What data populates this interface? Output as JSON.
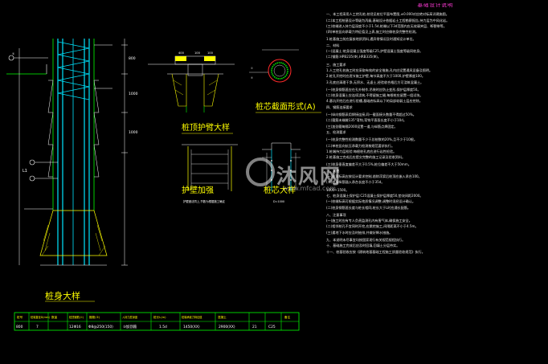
{
  "drawing": {
    "pile_body_title": "桩身大样",
    "pile_cap_title": "桩顶护臂大样",
    "wall_title": "护壁加强",
    "section_title": "桩芯截面形式(A)",
    "section2_title": "桩芯大样",
    "dim_labels": [
      "800",
      "1000",
      "1000",
      "L1"
    ],
    "cap_dims": [
      "400",
      "100",
      "100"
    ],
    "wall_note": "护壁做法同上,节数为根据施工确定",
    "d_label": "D=1000"
  },
  "table": {
    "headers": [
      "桩号",
      "桩端直径D(mm)",
      "数量",
      "桩顶钢筋(①)",
      "箍筋(②)",
      "入持力层深度",
      "桩长L(m)",
      "桩端承载力特征值",
      "混凝土",
      "备注"
    ],
    "row": [
      "800",
      "7",
      "12Φ16",
      "Φ8@250(150)",
      "③加劲箍",
      "1.5d",
      "1450(XX)",
      "2900(XX)",
      "21",
      "C25"
    ]
  },
  "notes": {
    "title": "基础设计说明",
    "lines": [
      "一、本工程采用人工挖孔桩,桩径见桩位平面布置图,±0.000对应绝对标高详建施图。",
      "(二)本工程桩基设计等级为丙级,基础设计依据岩土工程勘察报告,持力层为中风化岩。",
      "(三)桩端进入持力层深度不小于1.5d,桩端以下3d范围内应无软弱夹层、断裂带等。",
      "(四)单桩竖向承载力特征值见上表,施工时应做桩身完整性检测。",
      "1.桩基施工前应复核地质资料,遇异常情况及时通知设计单位。",
      "二、材料",
      "(一)混凝土:桩身混凝土强度等级C25,护壁混凝土强度等级同桩身。",
      "(二)钢筋:HPB235(Φ),HRB335(Φ)。",
      "三、施工要求",
      "1.人工挖孔桩施工时应采取有效的安全措施,孔内应设置通风设备及照明。",
      "2.桩孔开挖时应逐节施工护壁,每节高度不大于1000,护壁厚度100。",
      "3.孔底应清理干净,无积水、无虚土,经验收合格后方可浇筑混凝土。",
      "(一)桩身钢筋笼应在孔外制作,吊装时应防止变形,保护层厚度50。",
      "(二)桩身混凝土应连续浇筑,不得留施工缝,每根桩应留置一组试块。",
      "4.基坑开挖后应进行验槽,基础底标高以下的局部软弱土层应挖除。",
      "四、钢筋连接要求",
      "(一)纵向钢筋采用焊接连接,同一截面接头数量不得超过50%。",
      "(二)箍筋末端做135°弯钩,弯钩平直段长度不小于10d。",
      "(三)加劲箍每隔2000设置一道,与纵筋点焊固定。",
      "五、检测要求",
      "(一)桩身完整性检测数量不少于总桩数的20%,且不少于10根。",
      "(二)单桩竖向抗压承载力检测按规范要求执行。",
      "1.桩端持力层检验:每根桩孔底应进行岩性检验。",
      "2.桩基施工完成后应提交完整的施工记录及验收资料。",
      "(三)桩身垂直度偏差不大于0.5%,桩位偏差不大于50mm。",
      "六、其他",
      "(一)桩顶标高应按设计要求控制,凿除浮浆后桩顶应嵌入承台100。",
      "(二)桩身纵筋锚入承台长度不小于35d。",
      "1000~1500。",
      "七、桩身混凝土保护层:C25混凝土保护层厚度50,垫块间距2000。",
      "(一)桩端标高可根据实际地质情况调整,调整时须经设计确认。",
      "(二)桩身钢筋笼长度与桩长相同,桩长大于L时应通长配筋。",
      "八、注意事项",
      "(一)施工时应有专人负责监测孔内有害气体,确保施工安全。",
      "(二)相邻桩孔不宜同时开挖,应跳挖施工,间隔距离不小于4.5m。",
      "(三)遇地下水时应及时抽排,并做好降水措施。",
      "九、本说明未尽事宜均按国家现行有关规范规程执行。",
      "十、基础施工完成后应及时回填,回填土分层夯实。",
      "十一、桩基验收应按《建筑地基基础工程施工质量验收规范》执行。"
    ]
  },
  "watermark": {
    "text": "沐风网",
    "url": "www.mfcad.com"
  },
  "colors": {
    "cyan": "#00e5ff",
    "green": "#00ff00",
    "yellow": "#ffff00",
    "magenta": "#ff00ff",
    "red": "#ff2a2a",
    "white": "#ffffff"
  }
}
